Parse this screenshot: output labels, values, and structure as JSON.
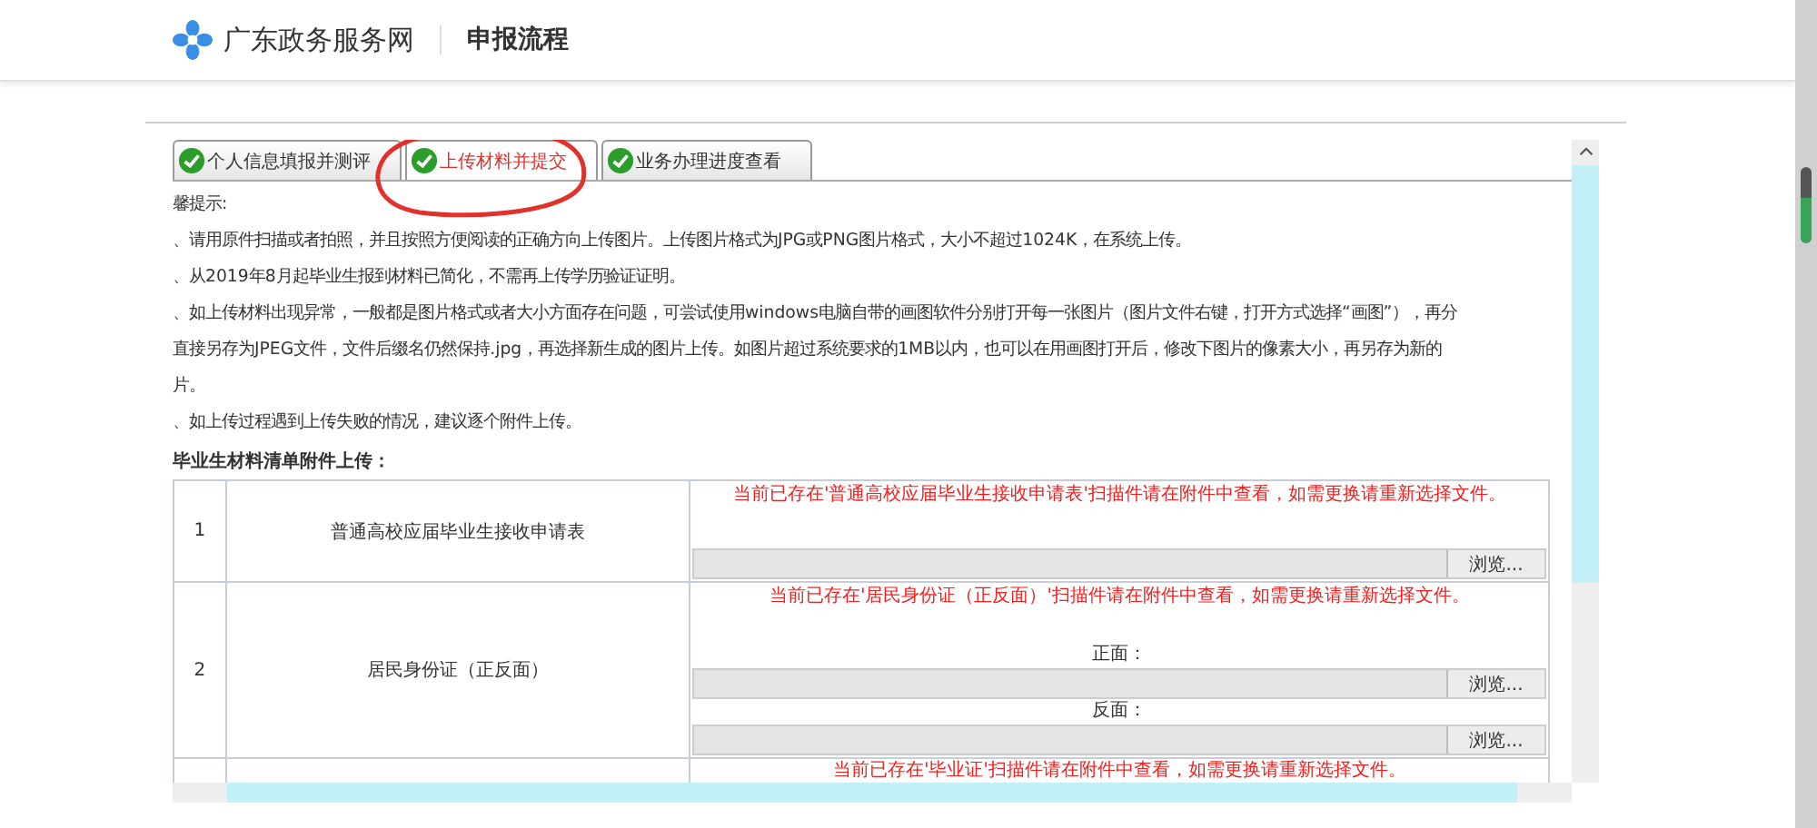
{
  "header": {
    "site_name": "广东政务服务网",
    "page_title": "申报流程"
  },
  "tabs": [
    {
      "label": "个人信息填报并测评",
      "selected": false
    },
    {
      "label": "上传材料并提交",
      "selected": true
    },
    {
      "label": "业务办理进度查看",
      "selected": false
    }
  ],
  "tips": [
    "馨提示:",
    "、请用原件扫描或者拍照，并且按照方便阅读的正确方向上传图片。上传图片格式为JPG或PNG图片格式，大小不超过1024K，在系统上传。",
    "、从2019年8月起毕业生报到材料已简化，不需再上传学历验证证明。",
    "、如上传材料出现异常，一般都是图片格式或者大小方面存在问题，可尝试使用windows电脑自带的画图软件分别打开每一张图片（图片文件右键，打开方式选择“画图”），再分",
    "直接另存为JPEG文件，文件后缀名仍然保持.jpg，再选择新生成的图片上传。如图片超过系统要求的1MB以内，也可以在用画图打开后，修改下图片的像素大小，再另存为新的",
    "片。",
    "、如上传过程遇到上传失败的情况，建议逐个附件上传。"
  ],
  "table_title": "毕业生材料清单附件上传：",
  "rows": [
    {
      "index": "1",
      "name": "普通高校应届毕业生接收申请表",
      "notice": "当前已存在'普通高校应届毕业生接收申请表'扫描件请在附件中查看，如需更换请重新选择文件。",
      "uploads": [
        {
          "button": "浏览..."
        }
      ]
    },
    {
      "index": "2",
      "name": "居民身份证（正反面）",
      "notice": "当前已存在'居民身份证（正反面）'扫描件请在附件中查看，如需更换请重新选择文件。",
      "uploads": [
        {
          "label": "正面：",
          "button": "浏览..."
        },
        {
          "label": "反面：",
          "button": "浏览..."
        }
      ]
    },
    {
      "notice": "当前已存在'毕业证'扫描件请在附件中查看，如需更换请重新选择文件。",
      "uploads": []
    }
  ]
}
